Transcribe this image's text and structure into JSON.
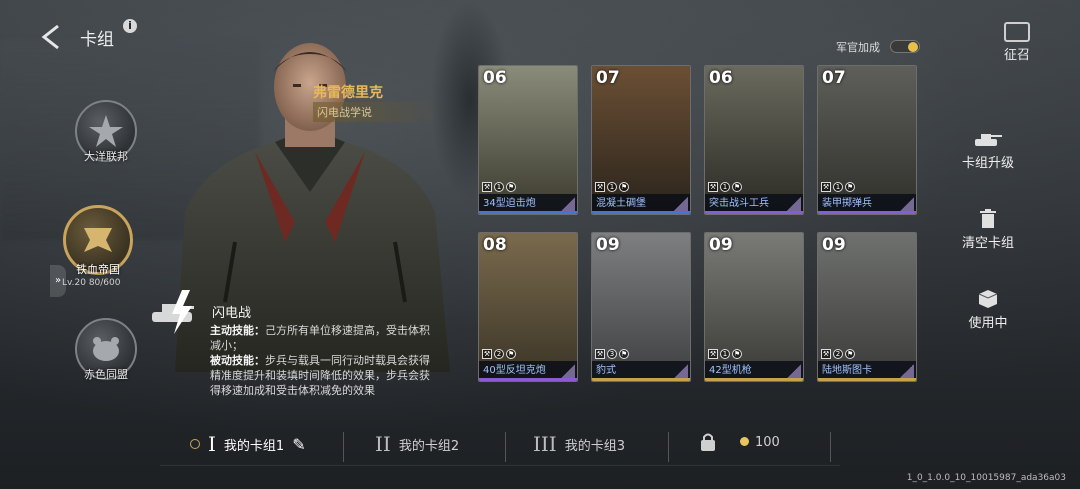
{
  "header": {
    "title": "卡组",
    "info_label": "i"
  },
  "factions": [
    {
      "label": "大洋联邦",
      "active": false
    },
    {
      "label": "铁血帝国",
      "active": true
    },
    {
      "label": "赤色同盟",
      "active": false
    }
  ],
  "level_text": "Lv.20  80/600",
  "commander": {
    "name": "弗雷德里克",
    "doctrine": "闪电战学说"
  },
  "skill": {
    "name": "闪电战",
    "active_label": "主动技能：",
    "active_text": "己方所有单位移速提高，受击体积减小；",
    "passive_label": "被动技能：",
    "passive_text": "步兵与载具一同行动时载具会获得精准度提升和装填时间降低的效果，步兵会获得移速加成和受击体积减免的效果"
  },
  "officer_bonus": {
    "label": "军官加成",
    "enabled": true
  },
  "summon": {
    "label": "征召"
  },
  "side_actions": [
    {
      "label": "卡组升级",
      "icon": "tank-icon"
    },
    {
      "label": "清空卡组",
      "icon": "trash-icon"
    },
    {
      "label": "使用中",
      "icon": "box-icon"
    }
  ],
  "cards": [
    {
      "cost": "06",
      "name": "34型迫击炮",
      "s1": "1",
      "rarity": "blue"
    },
    {
      "cost": "07",
      "name": "混凝土碉堡",
      "s1": "1",
      "rarity": "blue"
    },
    {
      "cost": "06",
      "name": "突击战斗工兵",
      "s1": "1",
      "rarity": "purple"
    },
    {
      "cost": "07",
      "name": "装甲掷弹兵",
      "s1": "1",
      "rarity": "purple"
    },
    {
      "cost": "08",
      "name": "40型反坦克炮",
      "s1": "2",
      "rarity": "purple"
    },
    {
      "cost": "09",
      "name": "豹式",
      "s1": "3",
      "rarity": "gold"
    },
    {
      "cost": "09",
      "name": "42型机枪",
      "s1": "1",
      "rarity": "gold"
    },
    {
      "cost": "09",
      "name": "陆地斯图卡",
      "s1": "2",
      "rarity": "gold"
    }
  ],
  "tabs": [
    {
      "numeral": "I",
      "label": "我的卡组1",
      "active": true
    },
    {
      "numeral": "II",
      "label": "我的卡组2",
      "active": false
    },
    {
      "numeral": "III",
      "label": "我的卡组3",
      "active": false
    }
  ],
  "currency": {
    "amount": "100"
  },
  "version": "1_0_1.0.0_10_10015987_ada36a03",
  "colors": {
    "blue": "#3f76d8",
    "purple": "#8a5bd6",
    "gold": "#c7a14b",
    "accent": "#e6c24a"
  }
}
